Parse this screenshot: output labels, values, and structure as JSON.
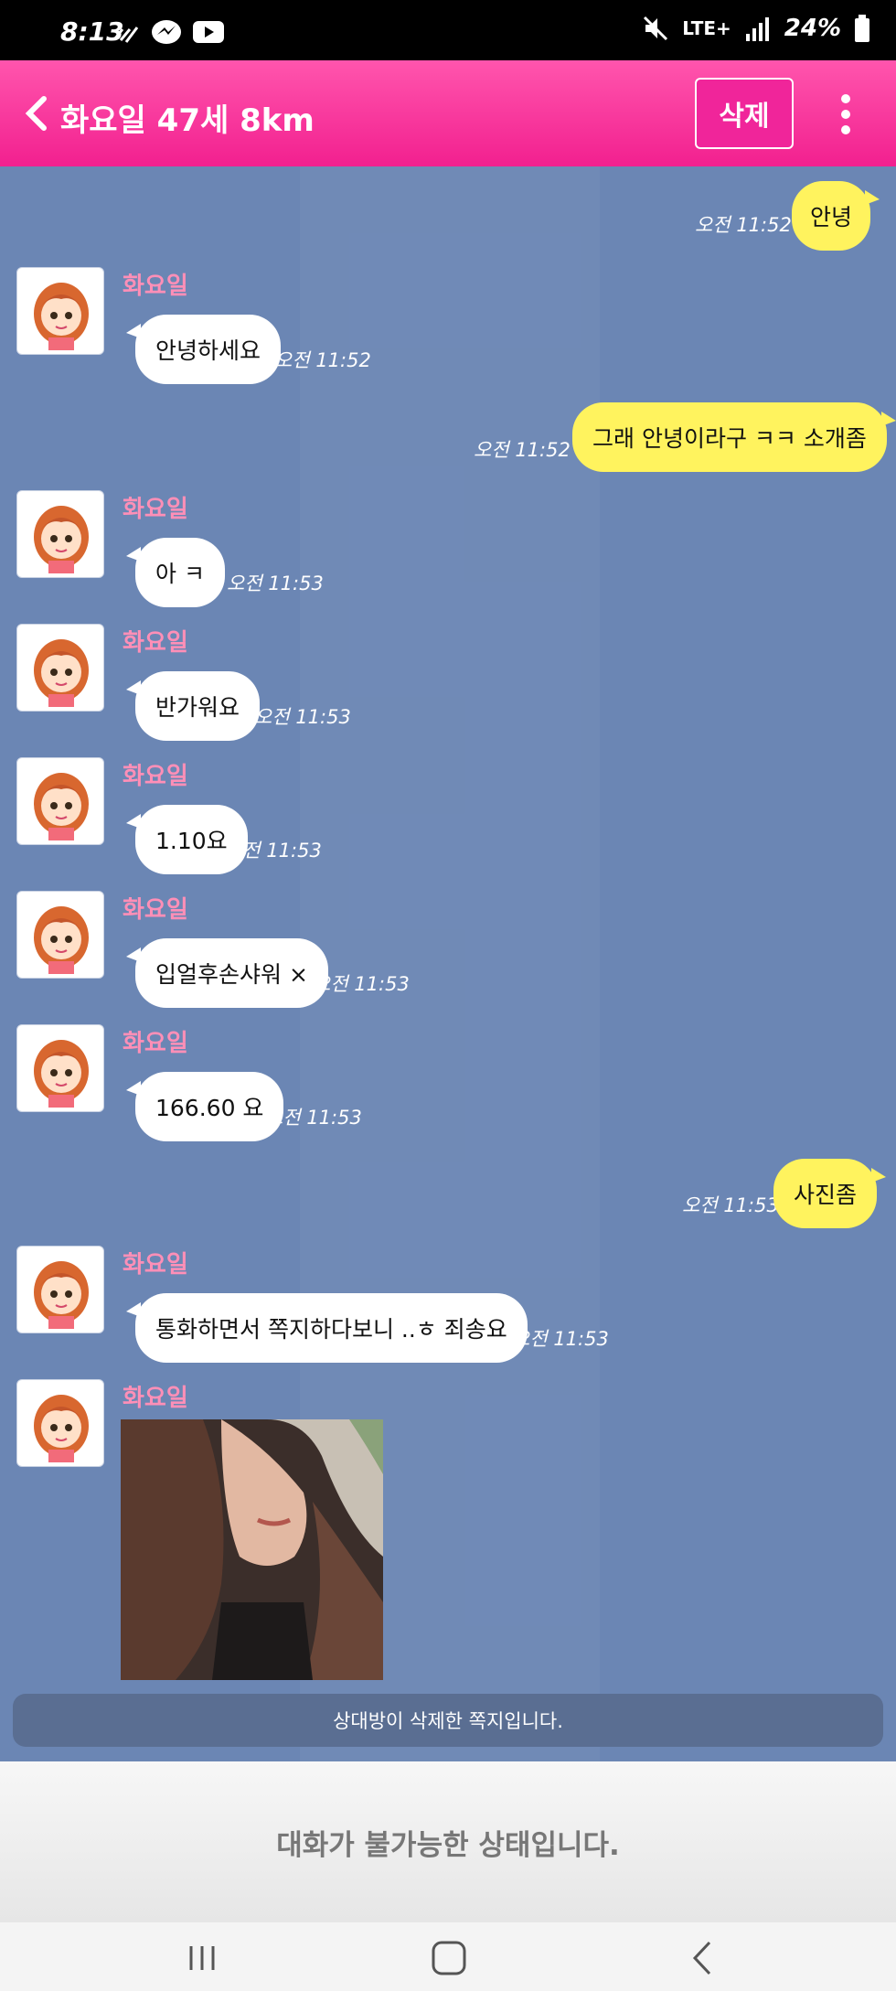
{
  "status_bar": {
    "time": "8:13",
    "network": "LTE+",
    "battery": "24%"
  },
  "header": {
    "title": "화요일 47세 8km",
    "delete_label": "삭제"
  },
  "messages": [
    {
      "text": "안녕",
      "time": "오전 11:52"
    },
    {
      "sender": "화요일",
      "text": "안녕하세요",
      "time": "오전 11:52"
    },
    {
      "text": "그래 안녕이라구 ㅋㅋ 소개좀",
      "time": "오전 11:52"
    },
    {
      "sender": "화요일",
      "text": "아 ㅋ",
      "time": "오전 11:53"
    },
    {
      "sender": "화요일",
      "text": "반가워요",
      "time": "오전 11:53"
    },
    {
      "sender": "화요일",
      "text": "1.10요",
      "time": "오전 11:53"
    },
    {
      "sender": "화요일",
      "text": "입얼후손샤워 ×",
      "time": "오전 11:53"
    },
    {
      "sender": "화요일",
      "text": "166.60 요",
      "time": "오전 11:53"
    },
    {
      "text": "사진좀",
      "time": "오전 11:53"
    },
    {
      "sender": "화요일",
      "text": "통화하면서 쪽지하다보니 ..ㅎ 죄송요",
      "time": "오전 11:53"
    },
    {
      "sender": "화요일"
    }
  ],
  "notice": "상대방이 삭제한 쪽지입니다.",
  "disabled_text": "대화가 불가능한 상태입니다.",
  "colors": {
    "header": "#f2208f",
    "outgoing_bubble": "#fff35e",
    "chat_bg": "#6b86b4"
  }
}
